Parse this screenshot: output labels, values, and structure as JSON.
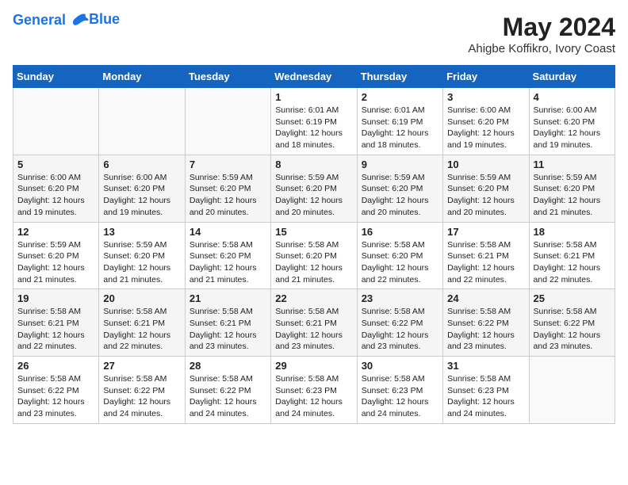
{
  "logo": {
    "line1": "General",
    "line2": "Blue"
  },
  "title": {
    "month_year": "May 2024",
    "location": "Ahigbe Koffikro, Ivory Coast"
  },
  "weekdays": [
    "Sunday",
    "Monday",
    "Tuesday",
    "Wednesday",
    "Thursday",
    "Friday",
    "Saturday"
  ],
  "weeks": [
    [
      {
        "day": "",
        "info": ""
      },
      {
        "day": "",
        "info": ""
      },
      {
        "day": "",
        "info": ""
      },
      {
        "day": "1",
        "info": "Sunrise: 6:01 AM\nSunset: 6:19 PM\nDaylight: 12 hours\nand 18 minutes."
      },
      {
        "day": "2",
        "info": "Sunrise: 6:01 AM\nSunset: 6:19 PM\nDaylight: 12 hours\nand 18 minutes."
      },
      {
        "day": "3",
        "info": "Sunrise: 6:00 AM\nSunset: 6:20 PM\nDaylight: 12 hours\nand 19 minutes."
      },
      {
        "day": "4",
        "info": "Sunrise: 6:00 AM\nSunset: 6:20 PM\nDaylight: 12 hours\nand 19 minutes."
      }
    ],
    [
      {
        "day": "5",
        "info": "Sunrise: 6:00 AM\nSunset: 6:20 PM\nDaylight: 12 hours\nand 19 minutes."
      },
      {
        "day": "6",
        "info": "Sunrise: 6:00 AM\nSunset: 6:20 PM\nDaylight: 12 hours\nand 19 minutes."
      },
      {
        "day": "7",
        "info": "Sunrise: 5:59 AM\nSunset: 6:20 PM\nDaylight: 12 hours\nand 20 minutes."
      },
      {
        "day": "8",
        "info": "Sunrise: 5:59 AM\nSunset: 6:20 PM\nDaylight: 12 hours\nand 20 minutes."
      },
      {
        "day": "9",
        "info": "Sunrise: 5:59 AM\nSunset: 6:20 PM\nDaylight: 12 hours\nand 20 minutes."
      },
      {
        "day": "10",
        "info": "Sunrise: 5:59 AM\nSunset: 6:20 PM\nDaylight: 12 hours\nand 20 minutes."
      },
      {
        "day": "11",
        "info": "Sunrise: 5:59 AM\nSunset: 6:20 PM\nDaylight: 12 hours\nand 21 minutes."
      }
    ],
    [
      {
        "day": "12",
        "info": "Sunrise: 5:59 AM\nSunset: 6:20 PM\nDaylight: 12 hours\nand 21 minutes."
      },
      {
        "day": "13",
        "info": "Sunrise: 5:59 AM\nSunset: 6:20 PM\nDaylight: 12 hours\nand 21 minutes."
      },
      {
        "day": "14",
        "info": "Sunrise: 5:58 AM\nSunset: 6:20 PM\nDaylight: 12 hours\nand 21 minutes."
      },
      {
        "day": "15",
        "info": "Sunrise: 5:58 AM\nSunset: 6:20 PM\nDaylight: 12 hours\nand 21 minutes."
      },
      {
        "day": "16",
        "info": "Sunrise: 5:58 AM\nSunset: 6:20 PM\nDaylight: 12 hours\nand 22 minutes."
      },
      {
        "day": "17",
        "info": "Sunrise: 5:58 AM\nSunset: 6:21 PM\nDaylight: 12 hours\nand 22 minutes."
      },
      {
        "day": "18",
        "info": "Sunrise: 5:58 AM\nSunset: 6:21 PM\nDaylight: 12 hours\nand 22 minutes."
      }
    ],
    [
      {
        "day": "19",
        "info": "Sunrise: 5:58 AM\nSunset: 6:21 PM\nDaylight: 12 hours\nand 22 minutes."
      },
      {
        "day": "20",
        "info": "Sunrise: 5:58 AM\nSunset: 6:21 PM\nDaylight: 12 hours\nand 22 minutes."
      },
      {
        "day": "21",
        "info": "Sunrise: 5:58 AM\nSunset: 6:21 PM\nDaylight: 12 hours\nand 23 minutes."
      },
      {
        "day": "22",
        "info": "Sunrise: 5:58 AM\nSunset: 6:21 PM\nDaylight: 12 hours\nand 23 minutes."
      },
      {
        "day": "23",
        "info": "Sunrise: 5:58 AM\nSunset: 6:22 PM\nDaylight: 12 hours\nand 23 minutes."
      },
      {
        "day": "24",
        "info": "Sunrise: 5:58 AM\nSunset: 6:22 PM\nDaylight: 12 hours\nand 23 minutes."
      },
      {
        "day": "25",
        "info": "Sunrise: 5:58 AM\nSunset: 6:22 PM\nDaylight: 12 hours\nand 23 minutes."
      }
    ],
    [
      {
        "day": "26",
        "info": "Sunrise: 5:58 AM\nSunset: 6:22 PM\nDaylight: 12 hours\nand 23 minutes."
      },
      {
        "day": "27",
        "info": "Sunrise: 5:58 AM\nSunset: 6:22 PM\nDaylight: 12 hours\nand 24 minutes."
      },
      {
        "day": "28",
        "info": "Sunrise: 5:58 AM\nSunset: 6:22 PM\nDaylight: 12 hours\nand 24 minutes."
      },
      {
        "day": "29",
        "info": "Sunrise: 5:58 AM\nSunset: 6:23 PM\nDaylight: 12 hours\nand 24 minutes."
      },
      {
        "day": "30",
        "info": "Sunrise: 5:58 AM\nSunset: 6:23 PM\nDaylight: 12 hours\nand 24 minutes."
      },
      {
        "day": "31",
        "info": "Sunrise: 5:58 AM\nSunset: 6:23 PM\nDaylight: 12 hours\nand 24 minutes."
      },
      {
        "day": "",
        "info": ""
      }
    ]
  ]
}
